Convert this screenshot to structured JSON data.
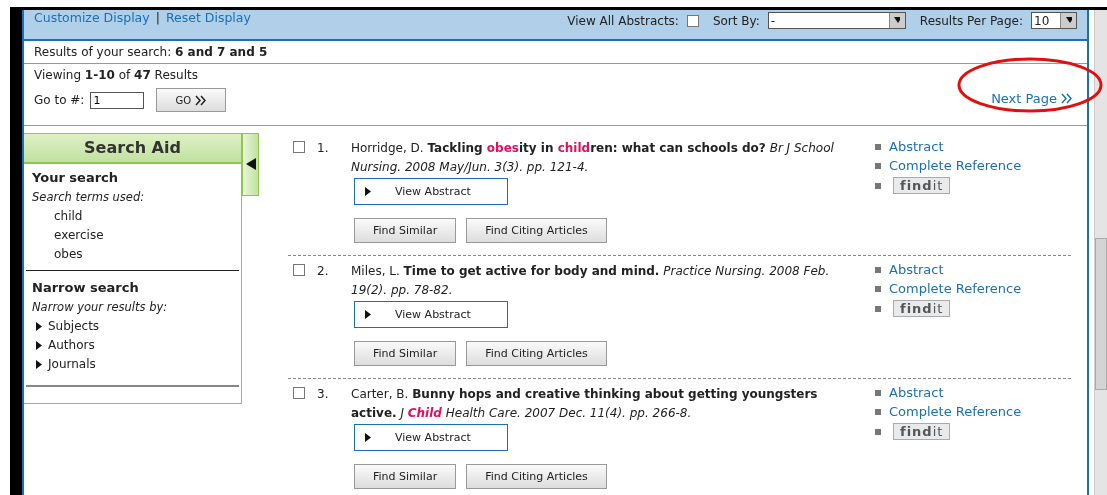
{
  "toolbar": {
    "links": [
      "Customize Display",
      "Reset Display"
    ],
    "separator": "|",
    "view_all_abstracts": {
      "label": "View All Abstracts:",
      "checked": false
    },
    "sort_by": {
      "label": "Sort By:",
      "value": "-"
    },
    "results_per_page": {
      "label": "Results Per Page:",
      "value": "10"
    }
  },
  "search_summary": "Results of your search: **6 and 7 and 5**",
  "viewing": "Viewing **1-10** of **47** Results",
  "goto": {
    "label": "Go to #:",
    "value": "1",
    "button": "GO"
  },
  "next_page": "Next Page",
  "search_aid": {
    "title": "Search Aid",
    "your_search": "Your search",
    "terms_label": "Search terms used:",
    "terms": [
      "child",
      "exercise",
      "obes"
    ],
    "narrow_search": "Narrow search",
    "narrow_label": "Narrow your results by:",
    "facets": [
      {
        "label": "Subjects",
        "expanded": false
      },
      {
        "label": "Authors",
        "expanded": false
      },
      {
        "label": "Journals",
        "expanded": false
      }
    ]
  },
  "results": [
    {
      "number": "1.",
      "checked": false,
      "citation": [
        {
          "kind": "plain",
          "text": "Horridge, D. "
        },
        {
          "kind": "bold",
          "text": "Tackling "
        },
        {
          "kind": "hit",
          "text": "obes"
        },
        {
          "kind": "bold",
          "text": "ity in "
        },
        {
          "kind": "hit",
          "text": "child"
        },
        {
          "kind": "bold",
          "text": "ren: what can schools do?"
        },
        {
          "kind": "italic",
          "text": " Br J School Nursing. 2008 May/Jun. 3(3). pp. 121-4."
        }
      ],
      "view_abstract": "View Abstract",
      "buttons": [
        "Find Similar",
        "Find Citing Articles"
      ],
      "links": [
        "Abstract",
        "Complete Reference"
      ],
      "findit": "**find**it"
    },
    {
      "number": "2.",
      "checked": false,
      "citation": [
        {
          "kind": "plain",
          "text": "Miles, L. "
        },
        {
          "kind": "bold",
          "text": "Time to get active for body and mind."
        },
        {
          "kind": "italic",
          "text": " Practice Nursing. 2008 Feb. 19(2). pp. 78-82."
        }
      ],
      "view_abstract": "View Abstract",
      "buttons": [
        "Find Similar",
        "Find Citing Articles"
      ],
      "links": [
        "Abstract",
        "Complete Reference"
      ],
      "findit": "**find**it"
    },
    {
      "number": "3.",
      "checked": false,
      "citation": [
        {
          "kind": "plain",
          "text": "Carter, B. "
        },
        {
          "kind": "bold",
          "text": "Bunny hops and creative thinking about getting youngsters active."
        },
        {
          "kind": "italic",
          "text": " J "
        },
        {
          "kind": "hit-italic",
          "text": "Child"
        },
        {
          "kind": "italic",
          "text": " Health Care. 2007 Dec. 11(4). pp. 266-8."
        }
      ],
      "view_abstract": "View Abstract",
      "buttons": [
        "Find Similar",
        "Find Citing Articles"
      ],
      "links": [
        "Abstract",
        "Complete Reference"
      ],
      "findit": "**find**it"
    }
  ]
}
